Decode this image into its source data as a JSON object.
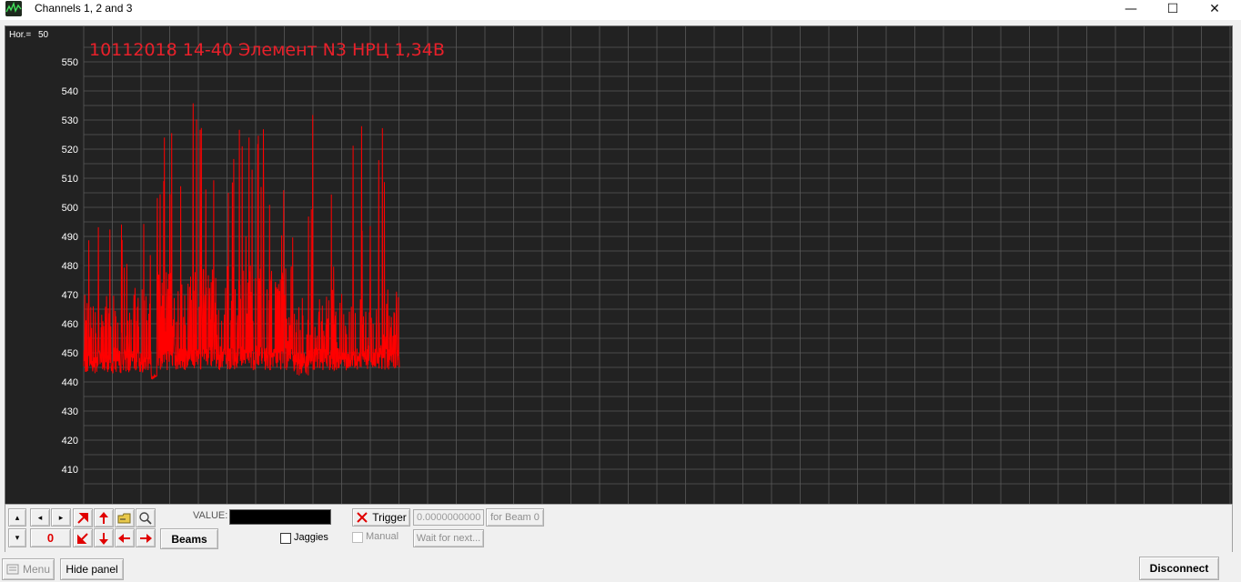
{
  "window": {
    "title": "Channels 1, 2 and 3",
    "minimize_glyph": "—",
    "maximize_glyph": "☐",
    "close_glyph": "✕"
  },
  "plot": {
    "hor_label": "Hor.=",
    "hor_value": "50",
    "title": "10112018 14-40 Элемент N3 НРЦ 1,34В",
    "title_color": "#e8202a",
    "trace_color": "#ff0000",
    "background": "#222222",
    "grid_color": "#5a5a5a",
    "label_color": "#ffffff"
  },
  "chart_data": {
    "type": "line",
    "title": "10112018 14-40 Элемент N3 НРЦ 1,34В",
    "xlabel": "",
    "ylabel": "",
    "ylim": [
      400,
      560
    ],
    "yticks": [
      410,
      420,
      430,
      440,
      450,
      460,
      470,
      480,
      490,
      500,
      510,
      520,
      530,
      540,
      550
    ],
    "grid": true,
    "series": [
      {
        "segments": [
          {
            "start": 0,
            "end": 120,
            "base": 443,
            "typical_peak": 470,
            "max_peak": 525
          },
          {
            "start": 120,
            "end": 130,
            "base": 441,
            "typical_peak": 441,
            "max_peak": 441
          },
          {
            "start": 130,
            "end": 370,
            "base": 444,
            "typical_peak": 480,
            "max_peak": 540
          },
          {
            "start": 370,
            "end": 400,
            "base": 442,
            "typical_peak": 465,
            "max_peak": 500
          },
          {
            "start": 400,
            "end": 560,
            "base": 444,
            "typical_peak": 472,
            "max_peak": 537
          }
        ]
      }
    ]
  },
  "panel": {
    "zero_counter": "0",
    "beams_label": "Beams",
    "value_label": "VALUE:",
    "jaggies_label": "Jaggies",
    "trigger_label": "Trigger",
    "trigger_value": "0.0000000000",
    "for_beam_label": "for Beam 0",
    "manual_label": "Manual",
    "wait_label": "Wait for next..."
  },
  "bottom": {
    "menu_label": "Menu",
    "hide_panel_label": "Hide panel",
    "disconnect_label": "Disconnect"
  },
  "icons": {
    "up": "▴",
    "down": "▾",
    "left": "◂",
    "right": "▸"
  }
}
